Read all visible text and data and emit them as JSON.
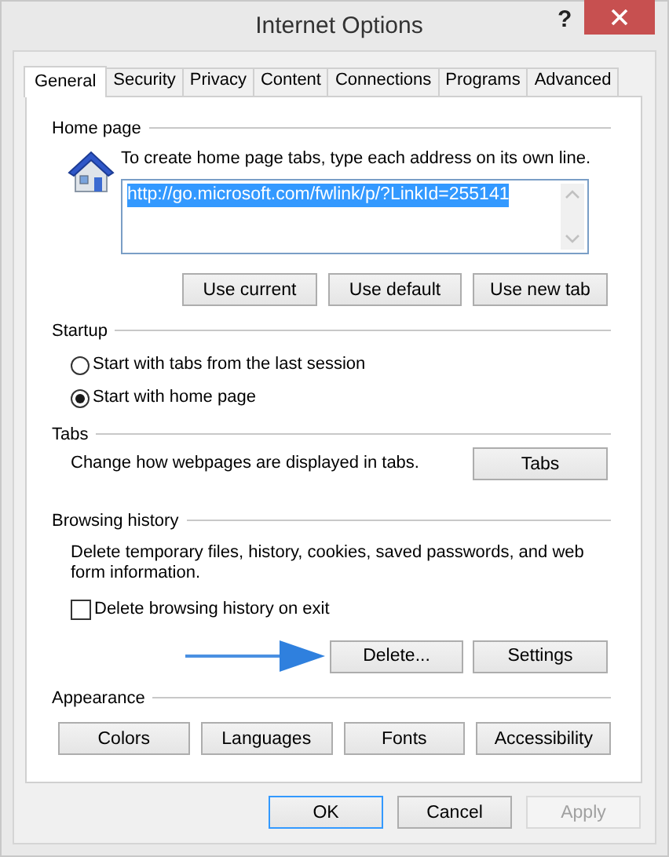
{
  "window": {
    "title": "Internet Options",
    "help": "?"
  },
  "tabs": [
    {
      "label": "General",
      "selected": true
    },
    {
      "label": "Security",
      "selected": false
    },
    {
      "label": "Privacy",
      "selected": false
    },
    {
      "label": "Content",
      "selected": false
    },
    {
      "label": "Connections",
      "selected": false
    },
    {
      "label": "Programs",
      "selected": false
    },
    {
      "label": "Advanced",
      "selected": false
    }
  ],
  "home_page": {
    "legend": "Home page",
    "description": "To create home page tabs, type each address on its own line.",
    "url": "http://go.microsoft.com/fwlink/p/?LinkId=255141",
    "url_highlighted": true,
    "buttons": [
      "Use current",
      "Use default",
      "Use new tab"
    ]
  },
  "startup": {
    "legend": "Startup",
    "options": [
      {
        "label": "Start with tabs from the last session",
        "selected": false
      },
      {
        "label": "Start with home page",
        "selected": true
      }
    ]
  },
  "tabs_section": {
    "legend": "Tabs",
    "description": "Change how webpages are displayed in tabs.",
    "button": "Tabs"
  },
  "browsing_history": {
    "legend": "Browsing history",
    "description": "Delete temporary files, history, cookies, saved passwords, and web form information.",
    "checkbox": {
      "label": "Delete browsing history on exit",
      "checked": false
    },
    "buttons": [
      "Delete...",
      "Settings"
    ]
  },
  "appearance": {
    "legend": "Appearance",
    "buttons": [
      "Colors",
      "Languages",
      "Fonts",
      "Accessibility"
    ]
  },
  "dialog_buttons": [
    {
      "label": "OK",
      "default": true,
      "disabled": false
    },
    {
      "label": "Cancel",
      "default": false,
      "disabled": false
    },
    {
      "label": "Apply",
      "default": false,
      "disabled": true
    }
  ]
}
